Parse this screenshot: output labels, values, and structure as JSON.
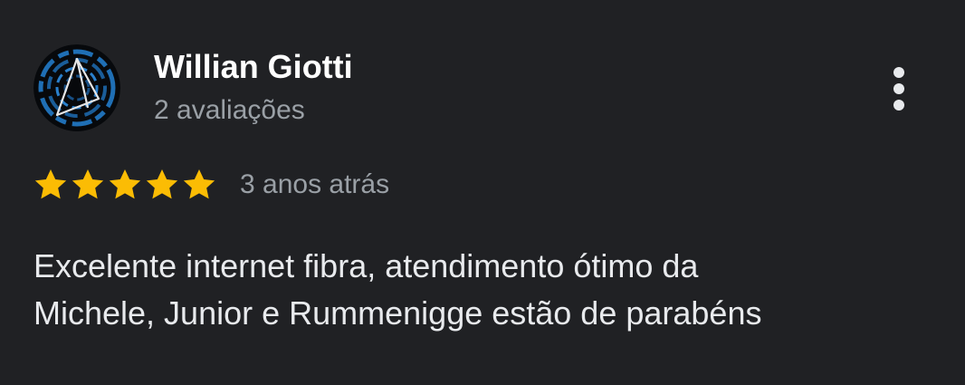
{
  "review": {
    "author_name": "Willian Giotti",
    "review_count": "2 avaliações",
    "rating": 5,
    "rating_max": 5,
    "time_ago": "3 anos atrás",
    "text": "Excelente internet fibra, atendimento ótimo da\nMichele, Junior e Rummenigge estão de parabéns",
    "menu_icon": "more-vert-icon",
    "star_icon": "star-icon"
  },
  "colors": {
    "background": "#202124",
    "author_name": "#ffffff",
    "secondary_text": "#9aa0a6",
    "body_text": "#e8eaed",
    "star": "#fbbc04",
    "avatar_accent": "#1f6fb5"
  }
}
